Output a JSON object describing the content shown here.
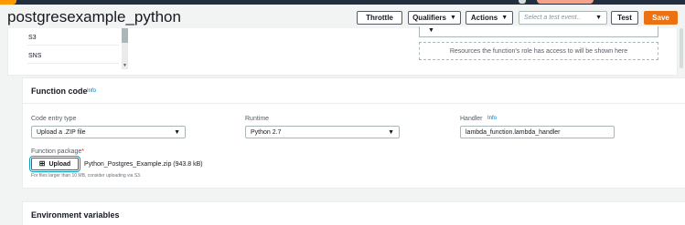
{
  "header": {
    "title": "postgresexample_python",
    "throttle_label": "Throttle",
    "qualifiers_label": "Qualifiers",
    "actions_label": "Actions",
    "event_placeholder": "Select a test event..",
    "test_label": "Test",
    "save_label": "Save"
  },
  "triggers_list": {
    "items": [
      "S3",
      "SNS"
    ]
  },
  "role_panel": {
    "note": "Resources the function's role has access to will be shown here"
  },
  "function_code": {
    "title": "Function code",
    "info": "Info",
    "entry_type_label": "Code entry type",
    "entry_type_value": "Upload a .ZIP file",
    "runtime_label": "Runtime",
    "runtime_value": "Python 2.7",
    "handler_label": "Handler",
    "handler_info": "Info",
    "handler_value": "lambda_function.lambda_handler",
    "package_label": "Function package",
    "package_required": "*",
    "upload_label": "Upload",
    "file_name": "Python_Postgres_Example.zip (943.8 kB)",
    "hint": "For files larger than 10 MB, consider uploading via S3."
  },
  "environment": {
    "title": "Environment variables"
  },
  "colors": {
    "topbar": "#232f3e",
    "save": "#ec7211",
    "link": "#0073bb",
    "focus": "#00a1c9"
  }
}
